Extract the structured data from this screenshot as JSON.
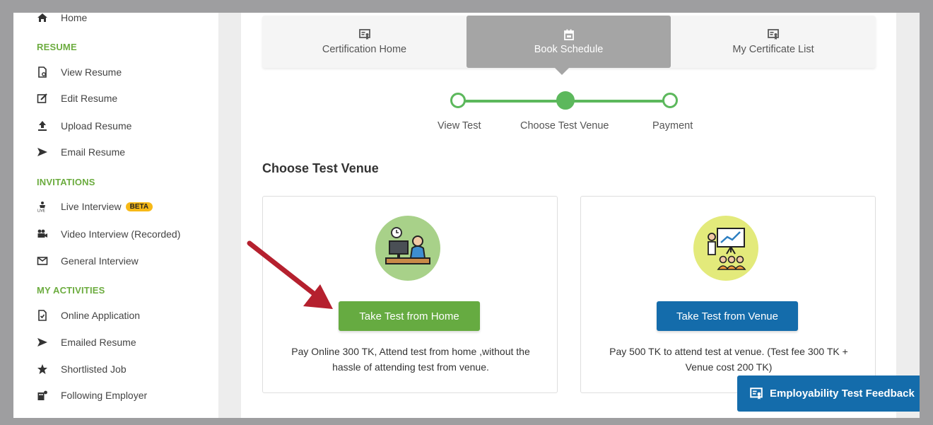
{
  "sidebar": {
    "home_label": "Home",
    "sections": {
      "resume": "RESUME",
      "invitations": "INVITATIONS",
      "activities": "MY ACTIVITIES"
    },
    "resume_items": [
      "View Resume",
      "Edit Resume",
      "Upload Resume",
      "Email Resume"
    ],
    "invitation_items": [
      "Live Interview",
      "Video Interview (Recorded)",
      "General Interview"
    ],
    "beta_badge": "BETA",
    "activity_items": [
      "Online Application",
      "Emailed Resume",
      "Shortlisted Job",
      "Following Employer"
    ],
    "icons": [
      "home-icon",
      "view-resume-icon",
      "edit-icon",
      "upload-icon",
      "send-icon",
      "live-icon",
      "video-camera-icon",
      "envelope-icon",
      "document-check-icon",
      "send-icon",
      "star-icon",
      "employer-icon"
    ]
  },
  "tabs": [
    {
      "label": "Certification Home",
      "icon": "certificate-icon",
      "active": false
    },
    {
      "label": "Book Schedule",
      "icon": "calendar-icon",
      "active": true
    },
    {
      "label": "My Certificate List",
      "icon": "certificate-icon",
      "active": false
    }
  ],
  "stepper": {
    "steps": [
      "View Test",
      "Choose Test Venue",
      "Payment"
    ],
    "current": 2
  },
  "venue": {
    "title": "Choose Test Venue",
    "home": {
      "button": "Take Test from Home",
      "description": "Pay Online 300 TK, Attend test from home ,without the hassle of attending test from venue.",
      "icon": "home-test-illustration"
    },
    "center": {
      "button": "Take Test from Venue",
      "description": "Pay 500 TK to attend test at venue. (Test fee 300 TK + Venue cost 200 TK)",
      "icon": "venue-presentation-illustration"
    }
  },
  "feedback_button": "Employability Test Feedback",
  "colors": {
    "accent_green": "#66ab41",
    "accent_blue": "#146cab",
    "section_green": "#6cac3f",
    "annotation_arrow": "#b5202e",
    "beta_yellow": "#f7b917"
  }
}
